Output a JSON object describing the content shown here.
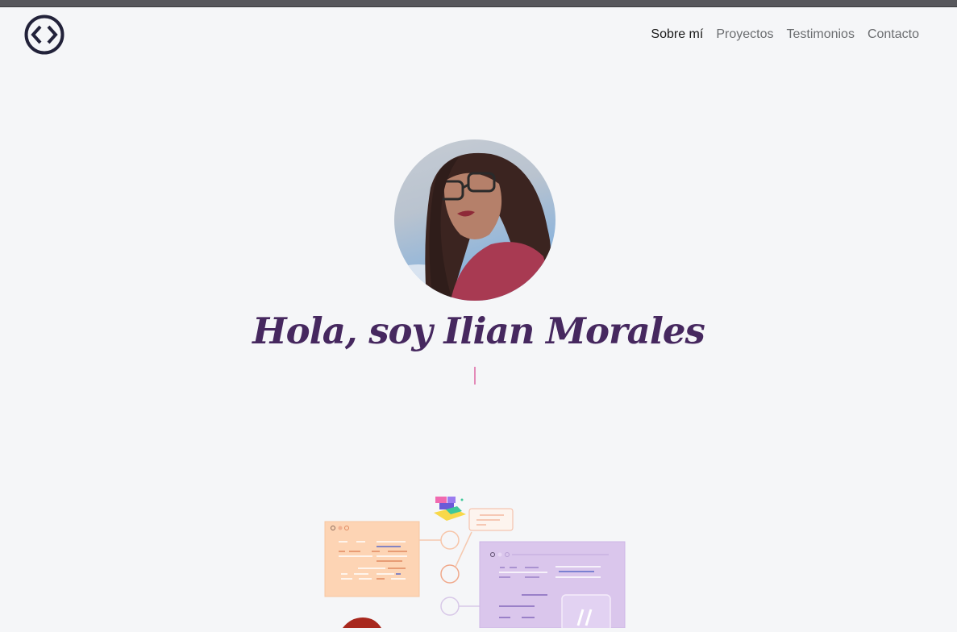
{
  "nav": {
    "logo_icon": "code-brackets-icon",
    "links": [
      {
        "label": "Sobre mí",
        "active": true
      },
      {
        "label": "Proyectos",
        "active": false
      },
      {
        "label": "Testimonios",
        "active": false
      },
      {
        "label": "Contacto",
        "active": false
      }
    ]
  },
  "hero": {
    "title": "Hola, soy Ilian Morales",
    "title_color": "#46285f",
    "cursor_color": "#e38ab8"
  },
  "illustration": {
    "icon": "dev-workflow-illustration"
  }
}
